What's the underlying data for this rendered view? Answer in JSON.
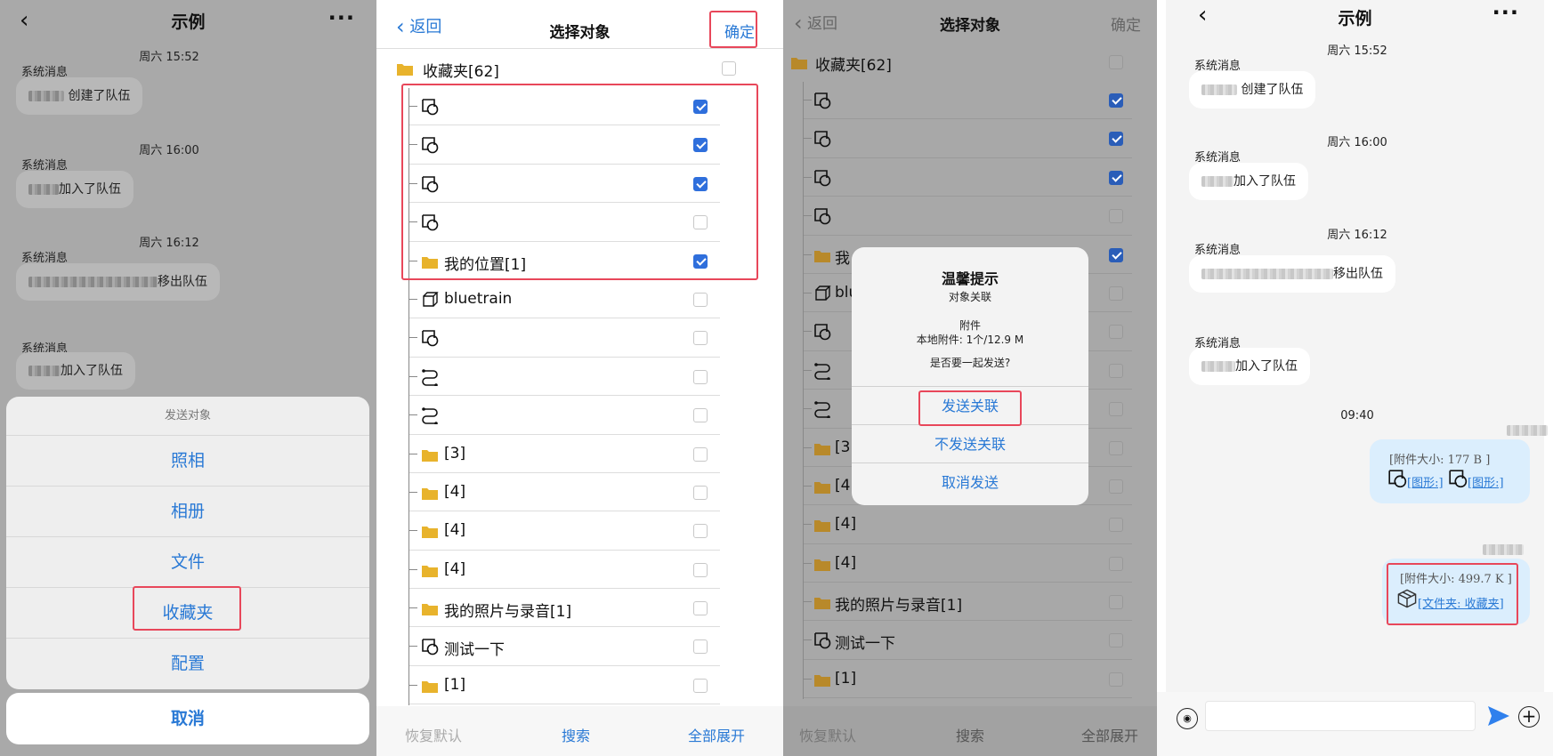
{
  "chat": {
    "title": "示例",
    "back_icon": "chevron-left-icon",
    "more_icon": "more-icon",
    "system_label": "系统消息",
    "messages": [
      {
        "time": "周六 15:52",
        "text": "创建了队伍"
      },
      {
        "time": "周六 16:00",
        "text": "加入了队伍"
      },
      {
        "time": "周六 16:12",
        "text": "移出队伍"
      },
      {
        "time": "",
        "text": "加入了队伍"
      }
    ],
    "time_0940": "09:40",
    "sent1": {
      "size": "[附件大小: 177 B ]",
      "link1": "[图形:]",
      "link2": "[图形:]"
    },
    "sent2": {
      "size": "[附件大小: 499.7 K ]",
      "link": "[文件夹: 收藏夹]"
    }
  },
  "sheet": {
    "title": "发送对象",
    "options": [
      "照相",
      "相册",
      "文件",
      "收藏夹",
      "配置"
    ],
    "cancel": "取消"
  },
  "selector": {
    "back": "返回",
    "title": "选择对象",
    "confirm": "确定",
    "root": "收藏夹[62]",
    "items": [
      {
        "label": "",
        "icon": "shape",
        "checked": true
      },
      {
        "label": "",
        "icon": "shape",
        "checked": true
      },
      {
        "label": "",
        "icon": "shape",
        "checked": true
      },
      {
        "label": "",
        "icon": "shape",
        "checked": false
      },
      {
        "label": "我的位置[1]",
        "icon": "folder",
        "checked": true
      },
      {
        "label": "bluetrain",
        "icon": "cube",
        "checked": false
      },
      {
        "label": "",
        "icon": "shape",
        "checked": false
      },
      {
        "label": "",
        "icon": "route",
        "checked": false
      },
      {
        "label": "",
        "icon": "route",
        "checked": false
      },
      {
        "label": "[3]",
        "icon": "folder",
        "checked": false
      },
      {
        "label": "[4]",
        "icon": "folder",
        "checked": false
      },
      {
        "label": "[4]",
        "icon": "folder",
        "checked": false
      },
      {
        "label": "[4]",
        "icon": "folder",
        "checked": false
      },
      {
        "label": "我的照片与录音[1]",
        "icon": "folder",
        "checked": false
      },
      {
        "label": "测试一下",
        "icon": "shape",
        "checked": false
      },
      {
        "label": "[1]",
        "icon": "folder",
        "checked": false
      }
    ],
    "bottom": {
      "reset": "恢复默认",
      "search": "搜索",
      "expand": "全部展开"
    }
  },
  "dialog": {
    "title": "温馨提示",
    "subtitle": "对象关联",
    "attach": "附件",
    "local": "本地附件: 1个/12.9 M",
    "question": "是否要一起发送?",
    "send_assoc": "发送关联",
    "no_assoc": "不发送关联",
    "cancel_send": "取消发送"
  },
  "p3_items": [
    "",
    "",
    "",
    "",
    "我",
    "blu",
    "",
    "",
    "",
    "[3",
    "[4",
    "[4]",
    "[4]",
    "我的照片与录音[1]",
    "测试一下",
    "[1]"
  ],
  "colors": {
    "accent": "#2979d5",
    "highlight": "#e8475a",
    "folder": "#e8b32c",
    "check": "#2f6fdc",
    "sent_bubble": "#dbeefd"
  }
}
